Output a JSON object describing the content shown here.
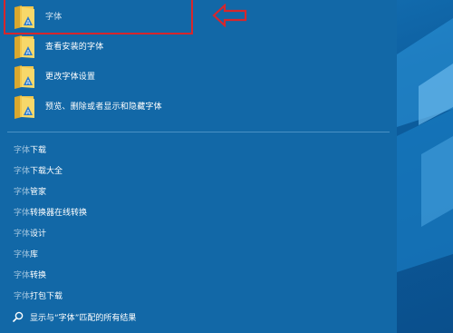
{
  "best_match": [
    {
      "label": "字体"
    },
    {
      "label": "查看安装的字体"
    },
    {
      "label": "更改字体设置"
    },
    {
      "label": "预览、删除或者显示和隐藏字体"
    }
  ],
  "web_suggestions": [
    {
      "query": "字体",
      "suffix": "下载"
    },
    {
      "query": "字体",
      "suffix": "下载大全"
    },
    {
      "query": "字体",
      "suffix": "管家"
    },
    {
      "query": "字体",
      "suffix": "转换器在线转换"
    },
    {
      "query": "字体",
      "suffix": "设计"
    },
    {
      "query": "字体",
      "suffix": "库"
    },
    {
      "query": "字体",
      "suffix": "转换"
    },
    {
      "query": "字体",
      "suffix": "打包下载"
    }
  ],
  "show_all": {
    "prefix": "显示与“",
    "query": "字体",
    "suffix": "”匹配的所有结果"
  },
  "colors": {
    "panel": "#1268a7",
    "highlight": "#d7262c",
    "folder": "#f2c74f"
  },
  "icons": {
    "folder": "folder-icon",
    "control_panel_badge": "control-panel-icon",
    "arrow": "left-arrow-icon",
    "search": "search-icon"
  }
}
